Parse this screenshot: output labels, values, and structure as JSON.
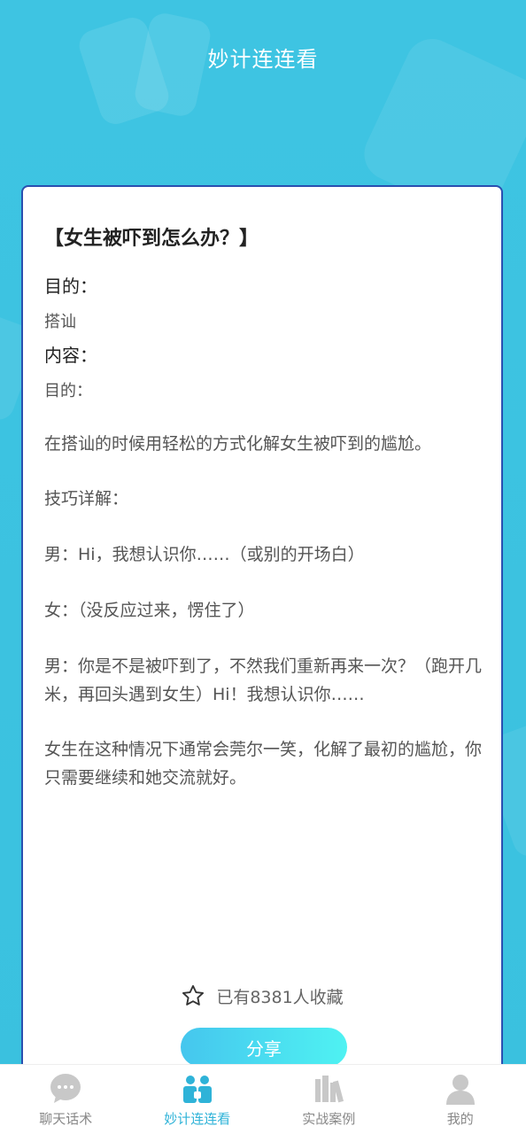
{
  "header": {
    "title": "妙计连连看"
  },
  "card": {
    "title": "【女生被吓到怎么办？】",
    "purpose_label": "目的：",
    "purpose_value": "搭讪",
    "content_label": "内容：",
    "content_purpose": "目的：",
    "paragraphs": [
      "在搭讪的时候用轻松的方式化解女生被吓到的尴尬。",
      "技巧详解：",
      "男：Hi，我想认识你……（或别的开场白）",
      "女：（没反应过来，愣住了）",
      "男：你是不是被吓到了，不然我们重新再来一次？（跑开几米，再回头遇到女生）Hi！我想认识你……",
      "女生在这种情况下通常会莞尔一笑，化解了最初的尴尬，你只需要继续和她交流就好。"
    ],
    "favorites_text": "已有8381人收藏",
    "share_label": "分享"
  },
  "tabs": [
    {
      "label": "聊天话术",
      "icon": "chat-bubble-icon"
    },
    {
      "label": "妙计连连看",
      "icon": "people-icon",
      "active": true
    },
    {
      "label": "实战案例",
      "icon": "books-icon"
    },
    {
      "label": "我的",
      "icon": "user-icon"
    }
  ],
  "colors": {
    "accent": "#2fb3d8",
    "background": "#3ec4e2",
    "card_border": "#2a4fb0"
  }
}
